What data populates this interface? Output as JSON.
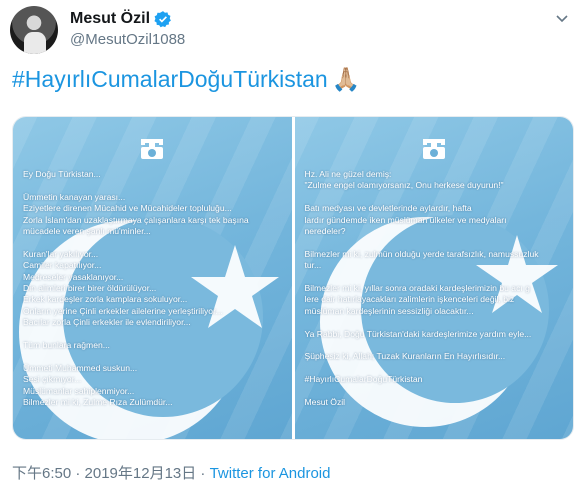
{
  "author": {
    "name": "Mesut Özil",
    "handle": "@MesutOzil1088"
  },
  "tweet": {
    "text": "#HayırlıCumalarDoğuTürkistan",
    "emoji": "🙏🏼"
  },
  "media": {
    "left_lines": [
      "Ey Doğu Türkistan...",
      "",
      "Ümmetin kanayan yarası...",
      "Eziyetlere direnen Mücahid ve Mücahideler topluluğu...",
      "Zorla İslam'dan uzaklaştırmaya çalışanlara karşı tek başına",
      "mücadele veren şanlı mü'minler...",
      "",
      "Kuran'lar yakılıyor...",
      "Camiler kapatılıyor...",
      "Medreseler yasaklanıyor...",
      "Din alimleri birer birer öldürülüyor...",
      "Erkek kardeşler zorla kamplara sokuluyor...",
      "Onların yerine Çinli erkekler ailelerine yerleştiriliyor...",
      "Bacılar zorla Çinli erkekler ile evlendiriliyor...",
      "",
      "Tüm bunlara rağmen...",
      "",
      "Ümmeti Muhammed suskun...",
      "Sesi çıkmıyor...",
      "Müslümanlar sahiplenmiyor...",
      "Bilmezler mi ki, Zulme Rıza Zulümdür..."
    ],
    "right_lines": [
      "Hz. Ali ne güzel demiş:",
      "\"Zulme engel olamıyorsanız, Onu herkese duyurun!\"",
      "",
      "Batı medyası ve devletlerinde aylardır, hafta",
      "lardır gündemde iken müslüman ülkeler ve medyaları",
      "neredeler?",
      "",
      "Bilmezler mi ki, zulmün olduğu yerde tarafsızlık, namussuzluk",
      "tur...",
      "",
      "Bilmezler mi ki, yıllar sonra oradaki kardeşlerimizin bu acı g",
      "lere dair hatırlayacakları zalimlerin işkenceleri değil, biz",
      "müslüman kardeşlerinin sessizliği olacaktır...",
      "",
      "Ya Rabbi, Doğu Türkistan'daki kardeşlerimize yardım eyle...",
      "",
      "Şüphesiz ki, Allah; Tuzak Kuranların En Hayırlısıdır...",
      "",
      "#HayırlıCumalarDoğuTürkistan",
      "",
      "Mesut Özil"
    ]
  },
  "footer": {
    "timestamp": "下午6:50 · 2019年12月13日 · ",
    "source": "Twitter for Android"
  },
  "colors": {
    "link": "#1b95e0",
    "secondary_text": "#657786",
    "flag_blue": "#74b6dc"
  }
}
